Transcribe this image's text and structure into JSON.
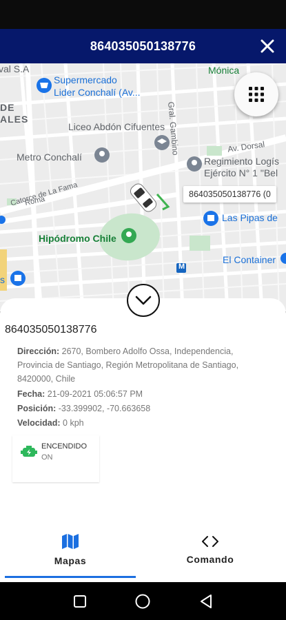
{
  "appbar": {
    "title": "864035050138776"
  },
  "map": {
    "labels": {
      "val_sa": "val S.A",
      "supermercado_1": "Supermercado",
      "supermercado_2": "Lider Conchalí (Av...",
      "monica": "Mónica",
      "de": "DE",
      "ales": "ALES",
      "liceo": "Liceo Abdón Cifuentes",
      "gral_gambino": "Gral. Gambino",
      "av_dorsal": "Av. Dorsal",
      "metro": "Metro Conchalí",
      "regimiento_1": "Regimiento Logís",
      "regimiento_2": "Ejército N° 1 \"Bel",
      "roma": "Roma",
      "catorce": "Catorce de La Fama",
      "las_pipas": "Las Pipas de",
      "hipodromo": "Hipódromo Chile",
      "container": "El Container",
      "fs": "s",
      "metro_marker": "M"
    },
    "tooltip": "864035050138776 (0"
  },
  "sheet": {
    "device_id": "864035050138776",
    "direccion_label": "Dirección:",
    "direccion_line1": "2670, Bombero Adolfo Ossa, Independencia,",
    "direccion_line2": "Provincia de Santiago, Región Metropolitana de Santiago,",
    "direccion_line3": "8420000, Chile",
    "fecha_label": "Fecha:",
    "fecha_value": "21-09-2021 05:06:57 PM",
    "posicion_label": "Posición:",
    "posicion_value": "-33.399902, -70.663658",
    "velocidad_label": "Velocidad:",
    "velocidad_value": "0 kph",
    "status_title": "ENCENDIDO",
    "status_sub": "ON"
  },
  "tabs": {
    "mapas": "Mapas",
    "comando": "Comando"
  },
  "colors": {
    "appbar": "#06186b",
    "accent": "#1b6fe0",
    "status_green": "#2eb85c"
  },
  "icons": {
    "close": "close-icon",
    "grid": "grid-menu-icon",
    "chevron": "chevron-down-icon",
    "engine": "engine-on-icon",
    "map": "map-icon",
    "code": "code-icon",
    "recent": "nav-recent-icon",
    "home": "nav-home-icon",
    "back": "nav-back-icon"
  }
}
